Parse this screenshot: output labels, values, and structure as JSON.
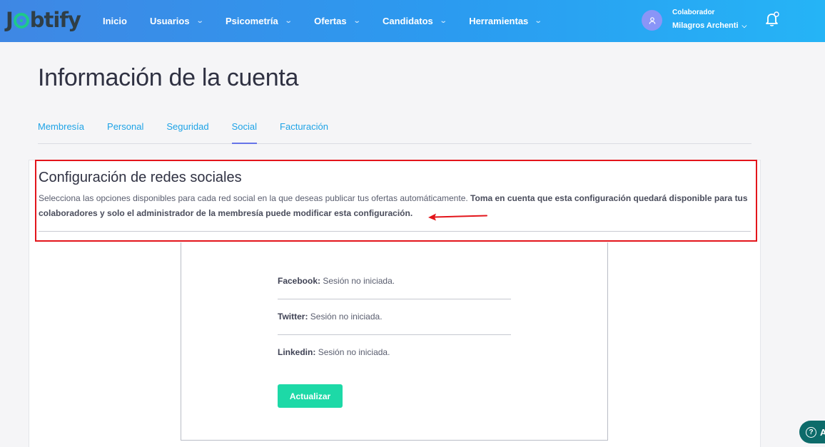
{
  "header": {
    "logo_text": "Jobtify",
    "nav": [
      {
        "label": "Inicio",
        "dropdown": false
      },
      {
        "label": "Usuarios",
        "dropdown": true
      },
      {
        "label": "Psicometría",
        "dropdown": true
      },
      {
        "label": "Ofertas",
        "dropdown": true
      },
      {
        "label": "Candidatos",
        "dropdown": true
      },
      {
        "label": "Herramientas",
        "dropdown": true
      }
    ],
    "user": {
      "role": "Colaborador",
      "name": "Milagros Archenti"
    },
    "colors": {
      "gradient_start": "#3f87e4",
      "gradient_end": "#25b4f6",
      "avatar": "#8a95f7"
    }
  },
  "page": {
    "title": "Información de la cuenta",
    "tabs": [
      {
        "label": "Membresía",
        "active": false
      },
      {
        "label": "Personal",
        "active": false
      },
      {
        "label": "Seguridad",
        "active": false
      },
      {
        "label": "Social",
        "active": true
      },
      {
        "label": "Facturación",
        "active": false
      }
    ]
  },
  "social_config": {
    "title": "Configuración de redes sociales",
    "description": "Selecciona las opciones disponibles para cada red social en la que deseas publicar tus ofertas automáticamente.",
    "description_bold": "Toma en cuenta que esta configuración quedará disponible para tus colaboradores y solo el administrador de la membresía puede modificar esta configuración.",
    "networks": [
      {
        "name": "Facebook:",
        "status": "Sesión no iniciada."
      },
      {
        "name": "Twitter:",
        "status": "Sesión no iniciada."
      },
      {
        "name": "Linkedin:",
        "status": "Sesión no iniciada."
      }
    ],
    "update_button": "Actualizar",
    "colors": {
      "highlight": "#e3151b",
      "button": "#1dd9a7",
      "tab_active": "#6674e8",
      "tab_text": "#1ea3e6"
    }
  },
  "help": {
    "label": "A"
  }
}
